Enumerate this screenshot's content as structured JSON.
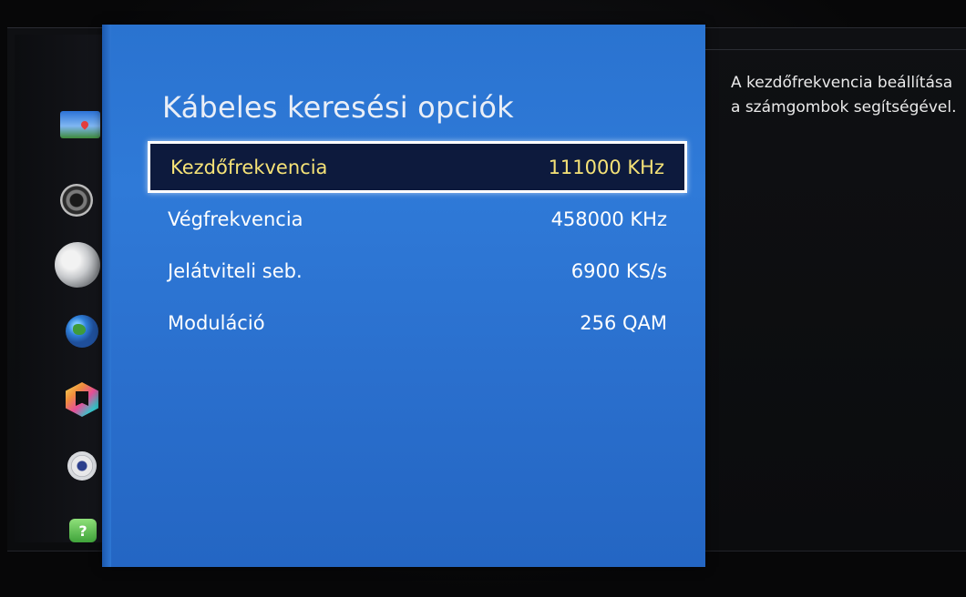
{
  "screen": {
    "title": "Kábeles keresési opciók",
    "help_text": "A kezdőfrekvencia beállítása a számgombok segítségével."
  },
  "sidebar": {
    "items": [
      {
        "icon": "picture-icon"
      },
      {
        "icon": "sound-icon"
      },
      {
        "icon": "broadcast-icon"
      },
      {
        "icon": "network-icon"
      },
      {
        "icon": "smart-features-icon"
      },
      {
        "icon": "system-icon"
      },
      {
        "icon": "support-icon",
        "glyph": "?"
      }
    ]
  },
  "menu": {
    "items": [
      {
        "label": "Kezdőfrekvencia",
        "value": "111000 KHz",
        "selected": true
      },
      {
        "label": "Végfrekvencia",
        "value": "458000 KHz",
        "selected": false
      },
      {
        "label": "Jelátviteli seb.",
        "value": "6900 KS/s",
        "selected": false
      },
      {
        "label": "Moduláció",
        "value": "256 QAM",
        "selected": false
      }
    ]
  },
  "colors": {
    "panel_blue": "#2a73d0",
    "selected_bg": "#0d1a3d",
    "selected_text": "#f5e277",
    "text": "#ffffff"
  }
}
